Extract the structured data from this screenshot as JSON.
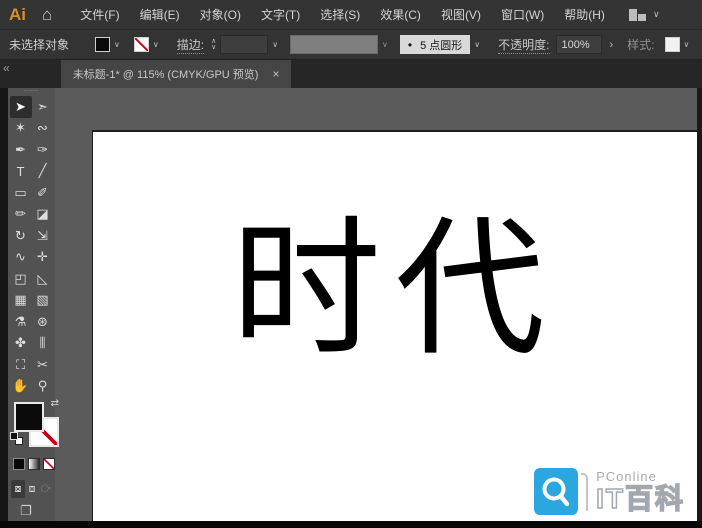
{
  "menubar": {
    "logo": "Ai",
    "home_icon": "⌂",
    "items": [
      {
        "id": "file",
        "label": "文件(F)"
      },
      {
        "id": "edit",
        "label": "编辑(E)"
      },
      {
        "id": "object",
        "label": "对象(O)"
      },
      {
        "id": "type",
        "label": "文字(T)"
      },
      {
        "id": "select",
        "label": "选择(S)"
      },
      {
        "id": "effect",
        "label": "效果(C)"
      },
      {
        "id": "view",
        "label": "视图(V)"
      },
      {
        "id": "window",
        "label": "窗口(W)"
      },
      {
        "id": "help",
        "label": "帮助(H)"
      }
    ],
    "workspace_chevron": "∨"
  },
  "controlbar": {
    "status": "未选择对象",
    "fill_chevron": "∨",
    "stroke_chevron": "∨",
    "stroke_label": "描边:",
    "stepper_up": "∧",
    "stepper_down": "∨",
    "weight_chevron": "∨",
    "profile_chevron": "∨",
    "brush_bullet": "•",
    "brush_value": "5 点圆形",
    "brush_chevron": "∨",
    "opacity_label": "不透明度:",
    "opacity_value": "100%",
    "opacity_arrow": "›",
    "style_label": "样式:",
    "style_chevron": "∨"
  },
  "tabbar": {
    "collapse_icon": "«",
    "tab_title": "未标题-1* @ 115% (CMYK/GPU 预览)",
    "close_icon": "×"
  },
  "toolbar": {
    "grip": "┄┄┄",
    "swap_icon": "⇄",
    "screen_mode_icon": "❐",
    "tools": [
      {
        "name": "selection-tool",
        "glyph": "➤",
        "selected": true
      },
      {
        "name": "direct-selection-tool",
        "glyph": "➣"
      },
      {
        "name": "magic-wand-tool",
        "glyph": "✶"
      },
      {
        "name": "lasso-tool",
        "glyph": "∾"
      },
      {
        "name": "pen-tool",
        "glyph": "✒"
      },
      {
        "name": "curvature-tool",
        "glyph": "✑"
      },
      {
        "name": "type-tool",
        "glyph": "T"
      },
      {
        "name": "line-segment-tool",
        "glyph": "╱"
      },
      {
        "name": "rectangle-tool",
        "glyph": "▭"
      },
      {
        "name": "paintbrush-tool",
        "glyph": "✐"
      },
      {
        "name": "shaper-tool",
        "glyph": "✏"
      },
      {
        "name": "eraser-tool",
        "glyph": "◪"
      },
      {
        "name": "rotate-tool",
        "glyph": "↻"
      },
      {
        "name": "scale-tool",
        "glyph": "⇲"
      },
      {
        "name": "width-tool",
        "glyph": "∿"
      },
      {
        "name": "puppet-warp-tool",
        "glyph": "✛"
      },
      {
        "name": "shape-builder-tool",
        "glyph": "◰"
      },
      {
        "name": "perspective-grid-tool",
        "glyph": "◺"
      },
      {
        "name": "mesh-tool",
        "glyph": "▦"
      },
      {
        "name": "gradient-tool",
        "glyph": "▧"
      },
      {
        "name": "eyedropper-tool",
        "glyph": "⚗"
      },
      {
        "name": "blend-tool",
        "glyph": "⊛"
      },
      {
        "name": "symbol-sprayer-tool",
        "glyph": "✤"
      },
      {
        "name": "column-graph-tool",
        "glyph": "⫼"
      },
      {
        "name": "artboard-tool",
        "glyph": "⛶"
      },
      {
        "name": "slice-tool",
        "glyph": "✂"
      },
      {
        "name": "hand-tool",
        "glyph": "✋"
      },
      {
        "name": "zoom-tool",
        "glyph": "⚲"
      }
    ],
    "modes": [
      {
        "name": "draw-normal-mode",
        "glyph": "⧇",
        "active": true
      },
      {
        "name": "draw-behind-mode",
        "glyph": "⧈"
      },
      {
        "name": "draw-inside-mode",
        "glyph": "⧂",
        "disabled": true
      }
    ]
  },
  "canvas": {
    "artboard_text": "时代"
  },
  "watermark": {
    "brand": "PConline",
    "title": "IT百科",
    "blue": "#29A7DE"
  },
  "colors": {
    "logo_orange": "#D98E2B",
    "stroke_none_red": "#c40016",
    "pasteboard_gray": "#5b5b5b",
    "panel_gray": "#525252",
    "bar_gray": "#333333"
  }
}
